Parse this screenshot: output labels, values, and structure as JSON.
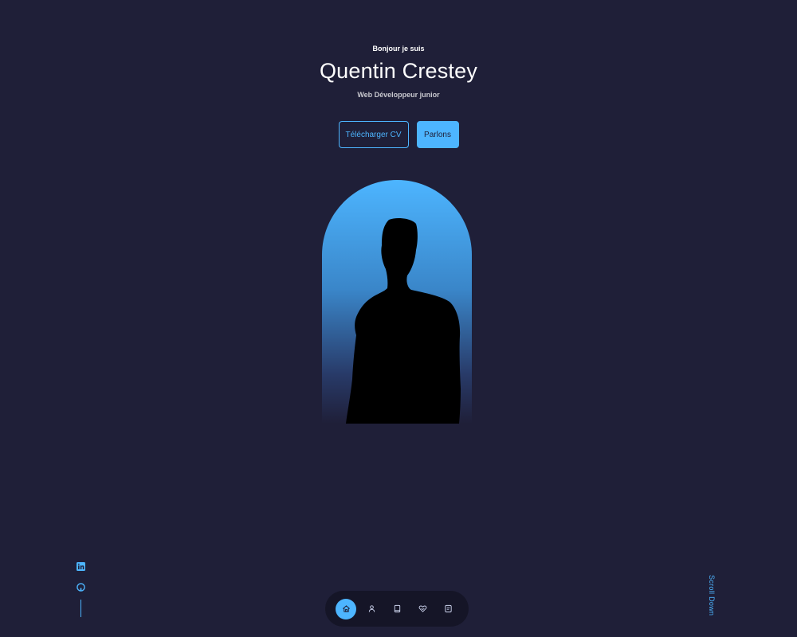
{
  "header": {
    "greeting": "Bonjour je suis",
    "name": "Quentin Crestey",
    "role": "Web Développeur junior"
  },
  "cta": {
    "download_label": "Télécharger CV",
    "contact_label": "Parlons"
  },
  "scroll": {
    "label": "Scroll Down"
  },
  "socials": [
    {
      "icon": "linkedin-icon"
    },
    {
      "icon": "github-icon"
    }
  ],
  "nav": [
    {
      "icon": "home-icon",
      "active": true
    },
    {
      "icon": "user-icon",
      "active": false
    },
    {
      "icon": "book-icon",
      "active": false
    },
    {
      "icon": "services-icon",
      "active": false
    },
    {
      "icon": "message-icon",
      "active": false
    }
  ],
  "colors": {
    "background": "#1f1f38",
    "accent": "#4db5ff",
    "text": "#ffffff"
  }
}
